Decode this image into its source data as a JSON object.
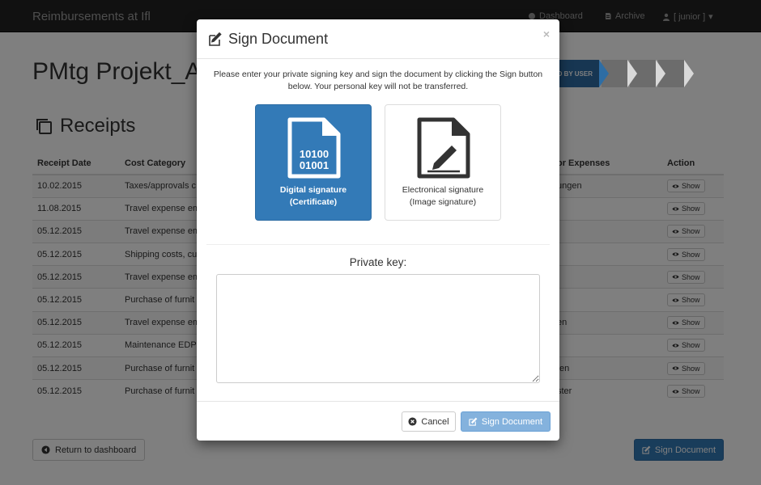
{
  "navbar": {
    "brand": "Reimbursements at Ifl",
    "dashboard": "Dashboard",
    "archive": "Archive",
    "user": "[ junior ]"
  },
  "page": {
    "title": "PMtg Projekt_A,",
    "status_step": "NED BY USER",
    "section_title": "Receipts"
  },
  "table": {
    "headers": [
      "Receipt Date",
      "Cost Category",
      "or Expenses",
      "Action"
    ],
    "rows": [
      {
        "date": "10.02.2015",
        "category": "Taxes/approvals c",
        "expenses": "ungen",
        "action": "Show"
      },
      {
        "date": "11.08.2015",
        "category": "Travel expense em",
        "expenses": "",
        "action": "Show"
      },
      {
        "date": "05.12.2015",
        "category": "Travel expense em",
        "expenses": "",
        "action": "Show"
      },
      {
        "date": "05.12.2015",
        "category": "Shipping costs, cus",
        "expenses": "",
        "action": "Show"
      },
      {
        "date": "05.12.2015",
        "category": "Travel expense em",
        "expenses": "",
        "action": "Show"
      },
      {
        "date": "05.12.2015",
        "category": "Purchase of furnit",
        "expenses": "",
        "action": "Show"
      },
      {
        "date": "05.12.2015",
        "category": "Travel expense em",
        "expenses": "en",
        "action": "Show"
      },
      {
        "date": "05.12.2015",
        "category": "Maintenance EDP",
        "expenses": "",
        "action": "Show"
      },
      {
        "date": "05.12.2015",
        "category": "Purchase of furnit",
        "expenses": "fen",
        "action": "Show"
      },
      {
        "date": "05.12.2015",
        "category": "Purchase of furnit",
        "expenses": "ster",
        "action": "Show"
      }
    ]
  },
  "footer": {
    "return_label": "Return to dashboard",
    "sign_label": "Sign Document"
  },
  "modal": {
    "title": "Sign Document",
    "close": "×",
    "instructions": "Please enter your private signing key and sign the document by clicking the Sign button below. Your personal key will not be transferred.",
    "digital": {
      "line1": "Digital signature",
      "line2": "(Certificate)",
      "binary1": "10100",
      "binary2": "01001"
    },
    "electronic": {
      "line1": "Electronical signature",
      "line2": "(Image signature)"
    },
    "private_key_label": "Private key:",
    "private_key_value": "",
    "cancel_label": "Cancel",
    "sign_label": "Sign Document"
  },
  "colors": {
    "primary": "#337ab7",
    "navbar": "#222222",
    "disabled_primary": "#84b2dd"
  }
}
